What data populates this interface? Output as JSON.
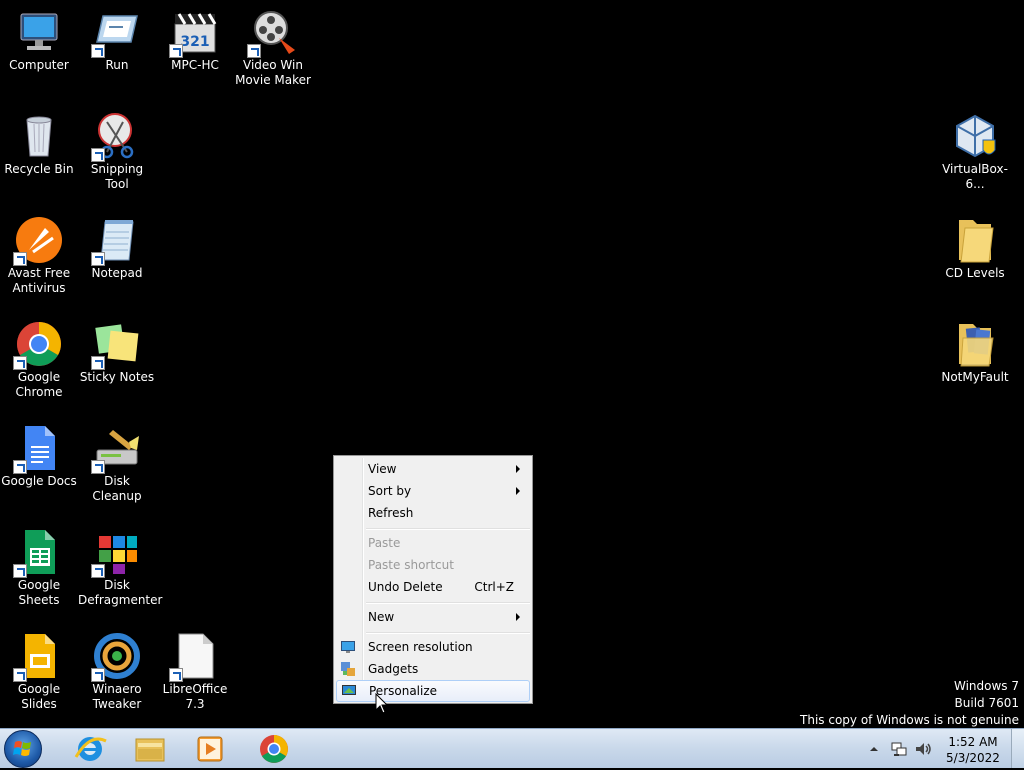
{
  "desktop": {
    "icons": [
      {
        "label": "Computer",
        "icon": "computer-icon"
      },
      {
        "label": "Run",
        "icon": "run-icon"
      },
      {
        "label": "MPC-HC",
        "icon": "mpc-hc-icon"
      },
      {
        "label": "Video Win Movie Maker",
        "icon": "movie-maker-icon"
      },
      {
        "label": "Recycle Bin",
        "icon": "recycle-bin-icon"
      },
      {
        "label": "Snipping Tool",
        "icon": "snipping-tool-icon"
      },
      {
        "label": "Avast Free Antivirus",
        "icon": "avast-icon"
      },
      {
        "label": "Notepad",
        "icon": "notepad-icon"
      },
      {
        "label": "Google Chrome",
        "icon": "chrome-icon"
      },
      {
        "label": "Sticky Notes",
        "icon": "sticky-notes-icon"
      },
      {
        "label": "Google Docs",
        "icon": "google-docs-icon"
      },
      {
        "label": "Disk Cleanup",
        "icon": "disk-cleanup-icon"
      },
      {
        "label": "Google Sheets",
        "icon": "google-sheets-icon"
      },
      {
        "label": "Disk Defragmenter",
        "icon": "disk-defragmenter-icon"
      },
      {
        "label": "Google Slides",
        "icon": "google-slides-icon"
      },
      {
        "label": "Winaero Tweaker",
        "icon": "winaero-tweaker-icon"
      },
      {
        "label": "LibreOffice 7.3",
        "icon": "libreoffice-icon"
      },
      {
        "label": "VirtualBox-6...",
        "icon": "virtualbox-icon"
      },
      {
        "label": "CD Levels",
        "icon": "folder-icon"
      },
      {
        "label": "NotMyFault",
        "icon": "folder-icon"
      }
    ]
  },
  "context_menu": {
    "view": "View",
    "sort_by": "Sort by",
    "refresh": "Refresh",
    "paste": "Paste",
    "paste_shortcut": "Paste shortcut",
    "undo_delete": "Undo Delete",
    "undo_delete_accel": "Ctrl+Z",
    "new": "New",
    "screen_resolution": "Screen resolution",
    "gadgets": "Gadgets",
    "personalize": "Personalize"
  },
  "watermark": {
    "line1": "Windows 7",
    "line2": "Build 7601",
    "line3": "This copy of Windows is not genuine"
  },
  "taskbar": {
    "pinned": [
      "internet-explorer-icon",
      "explorer-folder-icon",
      "media-player-icon",
      "chrome-icon"
    ],
    "time": "1:52 AM",
    "date": "5/3/2022"
  },
  "colors": {
    "desktop_bg": "#000000",
    "menu_bg": "#f0f0f0",
    "menu_hover_border": "#aecff7",
    "taskbar": "#c9d8ea"
  }
}
